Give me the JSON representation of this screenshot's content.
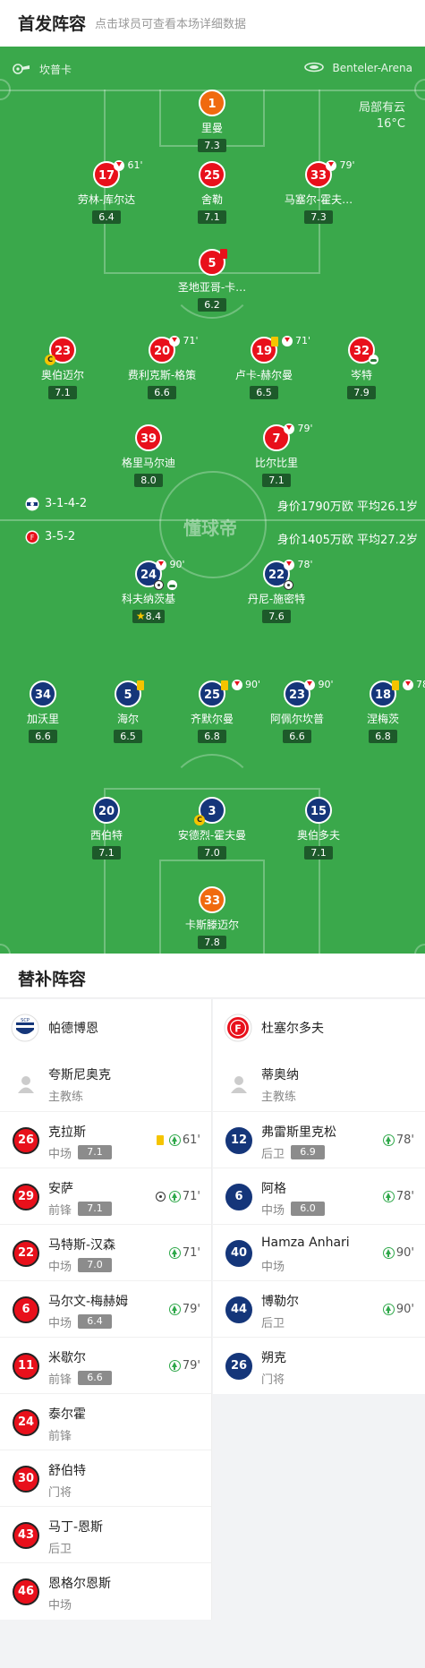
{
  "header": {
    "title": "首发阵容",
    "subtitle": "点击球员可查看本场详细数据"
  },
  "pitch": {
    "home_coach_label": "坎普卡",
    "venue": "Benteler-Arena",
    "weather_line1": "局部有云",
    "weather_line2": "16°C",
    "watermark": "懂球帝",
    "home_formation": "3-1-4-2",
    "home_info": "身价1790万欧 平均26.1岁",
    "away_formation": "3-5-2",
    "away_info": "身价1405万欧 平均27.2岁",
    "home_players": [
      {
        "num": "1",
        "name": "里曼",
        "rating": "7.3"
      },
      {
        "num": "17",
        "name": "劳林-库尔达",
        "rating": "6.4",
        "event": "61'"
      },
      {
        "num": "25",
        "name": "舍勒",
        "rating": "7.1"
      },
      {
        "num": "33",
        "name": "马塞尔-霍夫…",
        "rating": "7.3",
        "event": "79'"
      },
      {
        "num": "5",
        "name": "圣地亚哥-卡…",
        "rating": "6.2"
      },
      {
        "num": "23",
        "name": "奥伯迈尔",
        "rating": "7.1"
      },
      {
        "num": "20",
        "name": "费利克斯-格策",
        "rating": "6.6",
        "event": "71'"
      },
      {
        "num": "19",
        "name": "卢卡-赫尔曼",
        "rating": "6.5",
        "event": "71'"
      },
      {
        "num": "32",
        "name": "岑特",
        "rating": "7.9"
      },
      {
        "num": "39",
        "name": "格里马尔迪",
        "rating": "8.0"
      },
      {
        "num": "7",
        "name": "比尔比里",
        "rating": "7.1",
        "event": "79'"
      }
    ],
    "away_players": [
      {
        "num": "24",
        "name": "科夫纳茨基",
        "rating": "8.4",
        "event": "90'"
      },
      {
        "num": "22",
        "name": "丹尼-施密特",
        "rating": "7.6",
        "event": "78'"
      },
      {
        "num": "34",
        "name": "加沃里",
        "rating": "6.6"
      },
      {
        "num": "5",
        "name": "海尔",
        "rating": "6.5"
      },
      {
        "num": "25",
        "name": "齐默尔曼",
        "rating": "6.8",
        "event": "90'"
      },
      {
        "num": "23",
        "name": "阿佩尔坎普",
        "rating": "6.6",
        "event": "90'"
      },
      {
        "num": "18",
        "name": "涅梅茨",
        "rating": "6.8",
        "event": "78'"
      },
      {
        "num": "20",
        "name": "西伯特",
        "rating": "7.1"
      },
      {
        "num": "3",
        "name": "安德烈-霍夫曼",
        "rating": "7.0"
      },
      {
        "num": "15",
        "name": "奥伯多夫",
        "rating": "7.1"
      },
      {
        "num": "33",
        "name": "卡斯滕迈尔",
        "rating": "7.8"
      }
    ]
  },
  "subs": {
    "title": "替补阵容",
    "home": {
      "team": "帕德博恩",
      "coach_name": "夸斯尼奥克",
      "coach_role": "主教练",
      "players": [
        {
          "num": "26",
          "name": "克拉斯",
          "pos": "中场",
          "rating": "7.1",
          "min": "61'"
        },
        {
          "num": "29",
          "name": "安萨",
          "pos": "前锋",
          "rating": "7.1",
          "min": "71'"
        },
        {
          "num": "22",
          "name": "马特斯-汉森",
          "pos": "中场",
          "rating": "7.0",
          "min": "71'"
        },
        {
          "num": "6",
          "name": "马尔文-梅赫姆",
          "pos": "中场",
          "rating": "6.4",
          "min": "79'"
        },
        {
          "num": "11",
          "name": "米歇尔",
          "pos": "前锋",
          "rating": "6.6",
          "min": "79'"
        },
        {
          "num": "24",
          "name": "泰尔霍",
          "pos": "前锋"
        },
        {
          "num": "30",
          "name": "舒伯特",
          "pos": "门将"
        },
        {
          "num": "43",
          "name": "马丁-恩斯",
          "pos": "后卫"
        },
        {
          "num": "46",
          "name": "恩格尔恩斯",
          "pos": "中场"
        }
      ]
    },
    "away": {
      "team": "杜塞尔多夫",
      "coach_name": "蒂奥纳",
      "coach_role": "主教练",
      "players": [
        {
          "num": "12",
          "name": "弗雷斯里克松",
          "pos": "后卫",
          "rating": "6.9",
          "min": "78'"
        },
        {
          "num": "6",
          "name": "阿格",
          "pos": "中场",
          "rating": "6.0",
          "min": "78'"
        },
        {
          "num": "40",
          "name": "Hamza Anhari",
          "pos": "中场",
          "min": "90'"
        },
        {
          "num": "44",
          "name": "博勒尔",
          "pos": "后卫",
          "min": "90'"
        },
        {
          "num": "26",
          "name": "朔克",
          "pos": "门将"
        }
      ]
    }
  }
}
